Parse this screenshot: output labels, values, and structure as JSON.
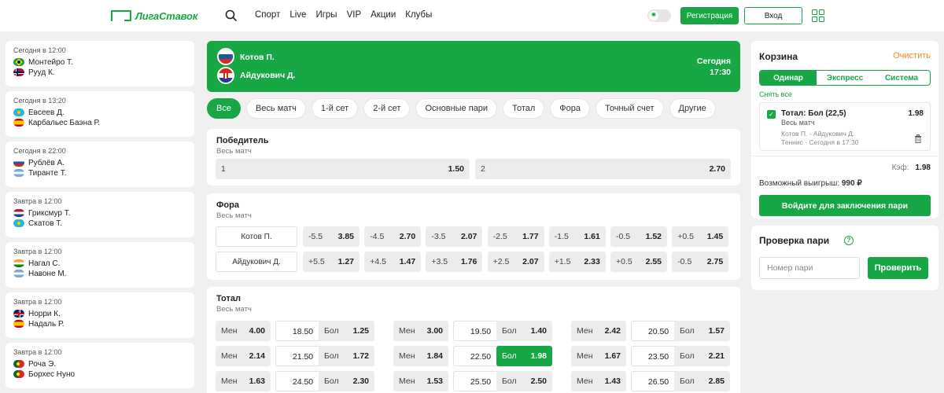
{
  "header": {
    "logo_text": "ЛигаСтавок",
    "nav": [
      "Спорт",
      "Live",
      "Игры",
      "VIP",
      "Акции",
      "Клубы"
    ],
    "register_label": "Регистрация",
    "login_label": "Вход",
    "toggle_symbol": "✷"
  },
  "left_matches": [
    {
      "time": "Сегодня в 12:00",
      "team1": "Монтейро Т.",
      "flag1": "br",
      "team2": "Рууд К.",
      "flag2": "no"
    },
    {
      "time": "Сегодня в 13:20",
      "team1": "Евсеев Д.",
      "flag1": "kz",
      "team2": "Карбальес Баэна Р.",
      "flag2": "es"
    },
    {
      "time": "Сегодня в 22:00",
      "team1": "Рублёв А.",
      "flag1": "ru",
      "team2": "Тиранте Т.",
      "flag2": "ar"
    },
    {
      "time": "Завтра в 12:00",
      "team1": "Гриксмур Т.",
      "flag1": "nl",
      "team2": "Скатов Т.",
      "flag2": "kz"
    },
    {
      "time": "Завтра в 12:00",
      "team1": "Нагал С.",
      "flag1": "in",
      "team2": "Навоне М.",
      "flag2": "ar"
    },
    {
      "time": "Завтра в 12:00",
      "team1": "Норри К.",
      "flag1": "gb",
      "team2": "Надаль Р.",
      "flag2": "es"
    },
    {
      "time": "Завтра в 12:00",
      "team1": "Роча Э.",
      "flag1": "pt",
      "team2": "Борхес Нуно",
      "flag2": "pt"
    }
  ],
  "event": {
    "team1": "Котов П.",
    "team2": "Айдукович Д.",
    "date": "Сегодня",
    "time": "17:30"
  },
  "filters": [
    "Все",
    "Весь матч",
    "1-й сет",
    "2-й сет",
    "Основные пари",
    "Тотал",
    "Фора",
    "Точный счет",
    "Другие"
  ],
  "winner": {
    "title": "Победитель",
    "sub": "Весь матч",
    "options": [
      {
        "label": "1",
        "odd": "1.50"
      },
      {
        "label": "2",
        "odd": "2.70"
      }
    ]
  },
  "handicap": {
    "title": "Фора",
    "sub": "Весь матч",
    "rows": [
      {
        "team": "Котов П.",
        "cells": [
          [
            "-5.5",
            "3.85"
          ],
          [
            "-4.5",
            "2.70"
          ],
          [
            "-3.5",
            "2.07"
          ],
          [
            "-2.5",
            "1.77"
          ],
          [
            "-1.5",
            "1.61"
          ],
          [
            "-0.5",
            "1.52"
          ],
          [
            "+0.5",
            "1.45"
          ]
        ]
      },
      {
        "team": "Айдукович Д.",
        "cells": [
          [
            "+5.5",
            "1.27"
          ],
          [
            "+4.5",
            "1.47"
          ],
          [
            "+3.5",
            "1.76"
          ],
          [
            "+2.5",
            "2.07"
          ],
          [
            "+1.5",
            "2.33"
          ],
          [
            "+0.5",
            "2.55"
          ],
          [
            "-0.5",
            "2.75"
          ]
        ]
      }
    ]
  },
  "total": {
    "title": "Тотал",
    "sub": "Весь матч",
    "under_label": "Мен",
    "over_label": "Бол",
    "rows": [
      [
        [
          "4.00",
          "18.50",
          "1.25"
        ],
        [
          "3.00",
          "19.50",
          "1.40"
        ],
        [
          "2.42",
          "20.50",
          "1.57"
        ]
      ],
      [
        [
          "2.14",
          "21.50",
          "1.72"
        ],
        [
          "1.84",
          "22.50",
          "1.98"
        ],
        [
          "1.67",
          "23.50",
          "2.21"
        ]
      ],
      [
        [
          "1.63",
          "24.50",
          "2.30"
        ],
        [
          "1.53",
          "25.50",
          "2.50"
        ],
        [
          "1.43",
          "26.50",
          "2.85"
        ]
      ]
    ],
    "selected": {
      "row": 1,
      "group": 1
    }
  },
  "basket": {
    "title": "Корзина",
    "clear_label": "Очистить",
    "tabs": [
      "Одинар",
      "Экспресс",
      "Система"
    ],
    "active_tab": 0,
    "remove_all": "Снять все",
    "bet": {
      "name": "Тотал: Бол (22,5)",
      "odd": "1.98",
      "sub": "Весь матч",
      "info1": "Котов П. - Айдукович Д.",
      "info2": "Теннис · Сегодня в 17:30"
    },
    "coef_label": "Кэф:",
    "coef_value": "1.98",
    "win_label": "Возможный выигрыш:",
    "win_value": "990 ₽",
    "login_button": "Войдите для заключения пари"
  },
  "bet_check": {
    "title": "Проверка пари",
    "help_symbol": "?",
    "placeholder": "Номер пари",
    "button": "Проверить"
  },
  "colors": {
    "accent": "#17a745",
    "clear": "#f08a24",
    "background": "#f0f0f0"
  }
}
